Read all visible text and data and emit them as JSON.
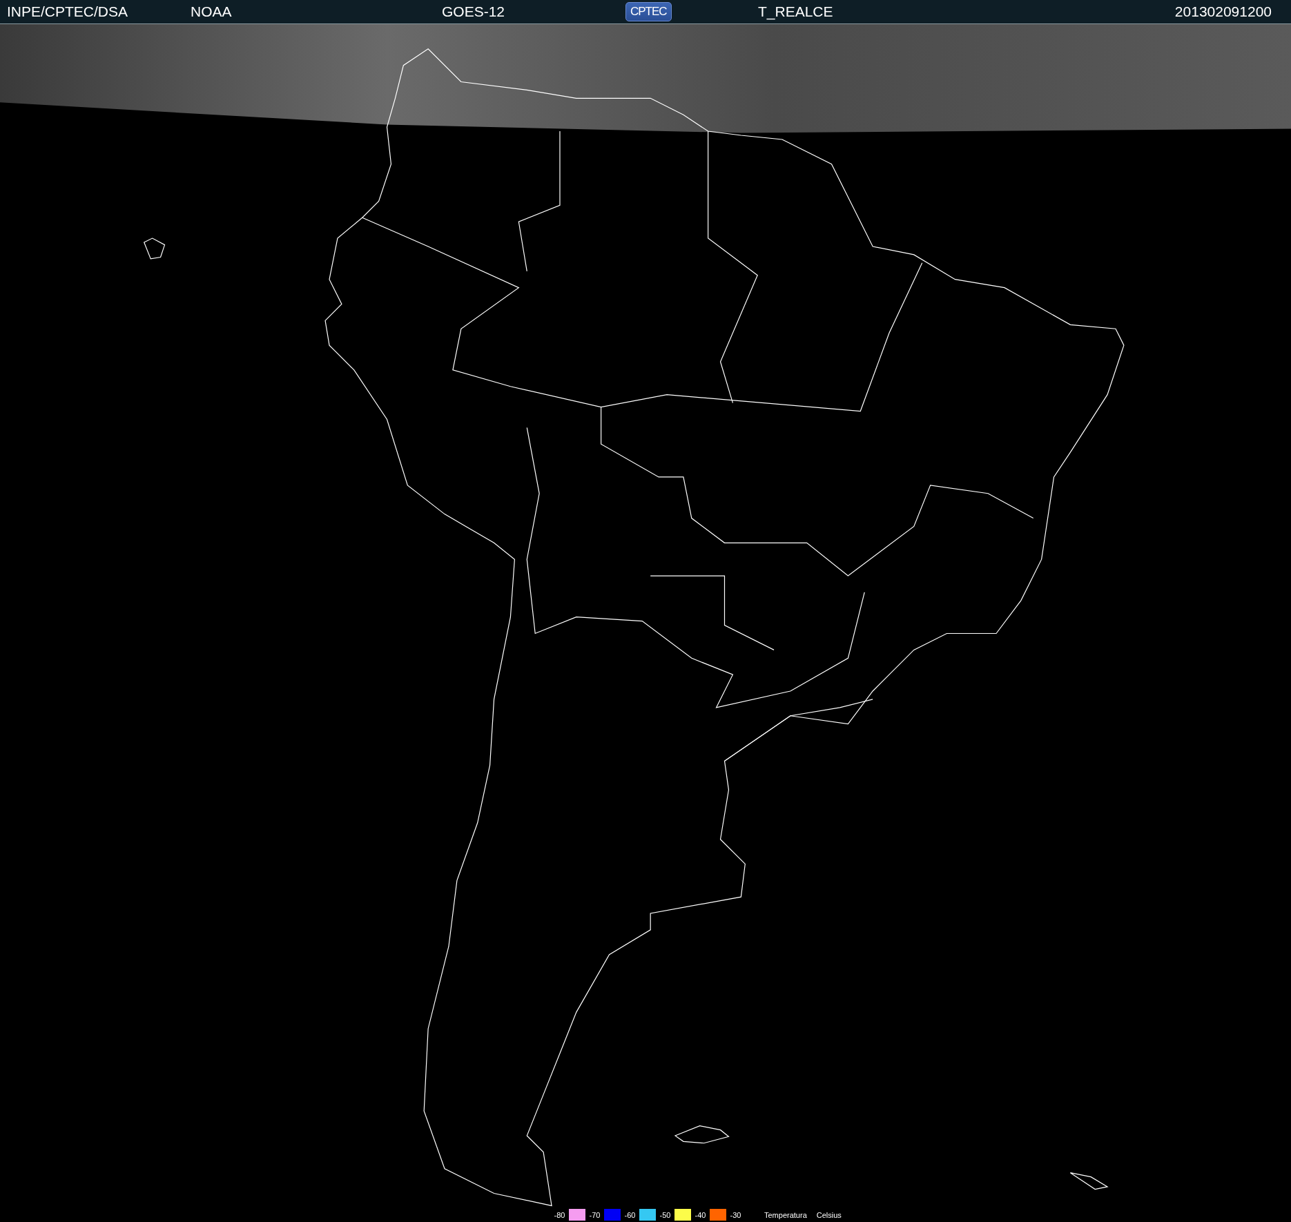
{
  "header": {
    "source": "INPE/CPTEC/DSA",
    "agency": "NOAA",
    "satellite": "GOES-12",
    "logo": "CPTEC",
    "product": "T_REALCE",
    "timestamp": "201302091200"
  },
  "legend": {
    "bands": [
      {
        "label": "-80",
        "color": "#f59cf0"
      },
      {
        "label": "-70",
        "color": "#0000f5"
      },
      {
        "label": "-60",
        "color": "#35c8f2"
      },
      {
        "label": "-50",
        "color": "#fcfc4a"
      },
      {
        "label": "-40",
        "color": "#ff6400"
      },
      {
        "label": "-30"
      }
    ],
    "quantity": "Temperatura",
    "unit": "Celsius"
  }
}
